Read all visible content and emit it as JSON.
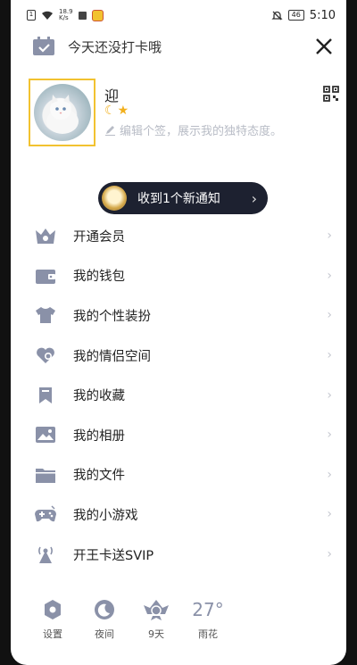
{
  "status_bar": {
    "speed": "18.9\nK/s",
    "time": "5:10",
    "battery": "46"
  },
  "header": {
    "checkin_text": "今天还没打卡哦"
  },
  "profile": {
    "name": "迎",
    "signature": "编辑个签，展示我的独特态度。"
  },
  "notification": {
    "text": "收到1个新通知"
  },
  "menu": {
    "items": [
      {
        "label": "开通会员",
        "icon": "vip-crown-icon"
      },
      {
        "label": "我的钱包",
        "icon": "wallet-icon"
      },
      {
        "label": "我的个性装扮",
        "icon": "tshirt-icon"
      },
      {
        "label": "我的情侣空间",
        "icon": "couple-heart-icon"
      },
      {
        "label": "我的收藏",
        "icon": "bookmark-icon"
      },
      {
        "label": "我的相册",
        "icon": "photo-album-icon"
      },
      {
        "label": "我的文件",
        "icon": "folder-icon"
      },
      {
        "label": "我的小游戏",
        "icon": "gamepad-icon"
      },
      {
        "label": "开王卡送SVIP",
        "icon": "signal-tower-icon"
      }
    ]
  },
  "bottom": {
    "settings": "设置",
    "night": "夜间",
    "days": "9天",
    "temperature": "27°",
    "weather": "雨花"
  },
  "colors": {
    "icon": "#8a91a8",
    "accent": "#f2c230",
    "pill": "#1d2130"
  }
}
